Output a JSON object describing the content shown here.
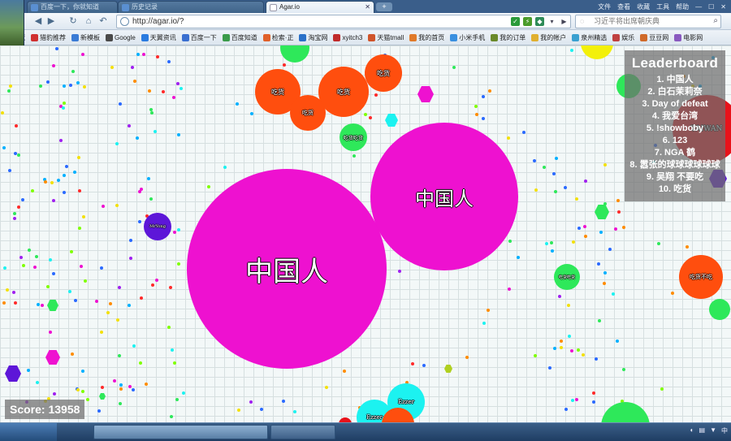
{
  "browser": {
    "tabs": [
      {
        "label": "百度一下，你就知道"
      },
      {
        "label": "历史记录"
      },
      {
        "label": "Agar.io"
      }
    ],
    "new_tab_label": "+",
    "window_controls": [
      "文件",
      "查看",
      "收藏",
      "工具",
      "帮助"
    ],
    "address_url": "http://agar.io/?",
    "search_placeholder": "习近平将出席朝庆典",
    "bookmarks": [
      "收藏",
      "猎豹推荐",
      "新模板",
      "Google",
      "天翼资讯",
      "百度一下",
      "百度知道",
      "检索·正",
      "淘宝网",
      "xyitch3",
      "天猫tmall",
      "我的首页",
      "小米手机",
      "我的订单",
      "我的帐户",
      "泉州精选",
      "娱乐",
      "豆豆网",
      "电影网"
    ]
  },
  "game": {
    "leaderboard_title": "Leaderboard",
    "leaderboard": [
      "1. 中国人",
      "2. 白石茉莉奈",
      "3. Day of defeat",
      "4. 我爱台湾",
      "5. !showboby",
      "6. 123",
      "7. NGA 鹤",
      "8. 嚣张的球球球球球球",
      "9. 吴翔  不要吃",
      "10. 吃货"
    ],
    "score_text": "Score: 13958",
    "cells": [
      {
        "name": "中国人",
        "color": "#ee11d0"
      },
      {
        "name": "中国人",
        "color": "#ee11d0"
      },
      {
        "name": "吃货",
        "color": "#ff4e0e"
      },
      {
        "name": "吃货",
        "color": "#ff4e0e"
      },
      {
        "name": "吃货",
        "color": "#ff4e0e"
      },
      {
        "name": "吃货",
        "color": "#ff4e0e"
      },
      {
        "name": "吃货吃货",
        "color": "#2ee85a"
      },
      {
        "name": "MrYong",
        "color": "#5d16d8"
      },
      {
        "name": "吃货吃货",
        "color": "#2ee85a"
      },
      {
        "name": "吃货不吃",
        "color": "#ff4e0e"
      },
      {
        "name": "Ezzer",
        "color": "#1cf2f0"
      },
      {
        "name": "Ezzer",
        "color": "#1cf2f0"
      },
      {
        "name": "TAIWAN",
        "color": "#e8121a"
      }
    ]
  }
}
